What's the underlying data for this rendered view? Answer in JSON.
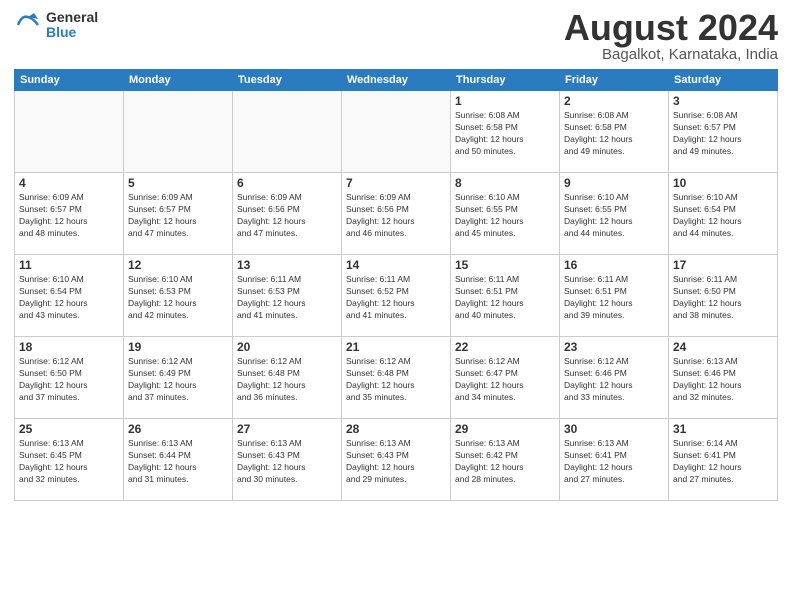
{
  "logo": {
    "general": "General",
    "blue": "Blue"
  },
  "title": {
    "month": "August 2024",
    "location": "Bagalkot, Karnataka, India"
  },
  "weekdays": [
    "Sunday",
    "Monday",
    "Tuesday",
    "Wednesday",
    "Thursday",
    "Friday",
    "Saturday"
  ],
  "weeks": [
    [
      {
        "day": "",
        "info": ""
      },
      {
        "day": "",
        "info": ""
      },
      {
        "day": "",
        "info": ""
      },
      {
        "day": "",
        "info": ""
      },
      {
        "day": "1",
        "info": "Sunrise: 6:08 AM\nSunset: 6:58 PM\nDaylight: 12 hours\nand 50 minutes."
      },
      {
        "day": "2",
        "info": "Sunrise: 6:08 AM\nSunset: 6:58 PM\nDaylight: 12 hours\nand 49 minutes."
      },
      {
        "day": "3",
        "info": "Sunrise: 6:08 AM\nSunset: 6:57 PM\nDaylight: 12 hours\nand 49 minutes."
      }
    ],
    [
      {
        "day": "4",
        "info": "Sunrise: 6:09 AM\nSunset: 6:57 PM\nDaylight: 12 hours\nand 48 minutes."
      },
      {
        "day": "5",
        "info": "Sunrise: 6:09 AM\nSunset: 6:57 PM\nDaylight: 12 hours\nand 47 minutes."
      },
      {
        "day": "6",
        "info": "Sunrise: 6:09 AM\nSunset: 6:56 PM\nDaylight: 12 hours\nand 47 minutes."
      },
      {
        "day": "7",
        "info": "Sunrise: 6:09 AM\nSunset: 6:56 PM\nDaylight: 12 hours\nand 46 minutes."
      },
      {
        "day": "8",
        "info": "Sunrise: 6:10 AM\nSunset: 6:55 PM\nDaylight: 12 hours\nand 45 minutes."
      },
      {
        "day": "9",
        "info": "Sunrise: 6:10 AM\nSunset: 6:55 PM\nDaylight: 12 hours\nand 44 minutes."
      },
      {
        "day": "10",
        "info": "Sunrise: 6:10 AM\nSunset: 6:54 PM\nDaylight: 12 hours\nand 44 minutes."
      }
    ],
    [
      {
        "day": "11",
        "info": "Sunrise: 6:10 AM\nSunset: 6:54 PM\nDaylight: 12 hours\nand 43 minutes."
      },
      {
        "day": "12",
        "info": "Sunrise: 6:10 AM\nSunset: 6:53 PM\nDaylight: 12 hours\nand 42 minutes."
      },
      {
        "day": "13",
        "info": "Sunrise: 6:11 AM\nSunset: 6:53 PM\nDaylight: 12 hours\nand 41 minutes."
      },
      {
        "day": "14",
        "info": "Sunrise: 6:11 AM\nSunset: 6:52 PM\nDaylight: 12 hours\nand 41 minutes."
      },
      {
        "day": "15",
        "info": "Sunrise: 6:11 AM\nSunset: 6:51 PM\nDaylight: 12 hours\nand 40 minutes."
      },
      {
        "day": "16",
        "info": "Sunrise: 6:11 AM\nSunset: 6:51 PM\nDaylight: 12 hours\nand 39 minutes."
      },
      {
        "day": "17",
        "info": "Sunrise: 6:11 AM\nSunset: 6:50 PM\nDaylight: 12 hours\nand 38 minutes."
      }
    ],
    [
      {
        "day": "18",
        "info": "Sunrise: 6:12 AM\nSunset: 6:50 PM\nDaylight: 12 hours\nand 37 minutes."
      },
      {
        "day": "19",
        "info": "Sunrise: 6:12 AM\nSunset: 6:49 PM\nDaylight: 12 hours\nand 37 minutes."
      },
      {
        "day": "20",
        "info": "Sunrise: 6:12 AM\nSunset: 6:48 PM\nDaylight: 12 hours\nand 36 minutes."
      },
      {
        "day": "21",
        "info": "Sunrise: 6:12 AM\nSunset: 6:48 PM\nDaylight: 12 hours\nand 35 minutes."
      },
      {
        "day": "22",
        "info": "Sunrise: 6:12 AM\nSunset: 6:47 PM\nDaylight: 12 hours\nand 34 minutes."
      },
      {
        "day": "23",
        "info": "Sunrise: 6:12 AM\nSunset: 6:46 PM\nDaylight: 12 hours\nand 33 minutes."
      },
      {
        "day": "24",
        "info": "Sunrise: 6:13 AM\nSunset: 6:46 PM\nDaylight: 12 hours\nand 32 minutes."
      }
    ],
    [
      {
        "day": "25",
        "info": "Sunrise: 6:13 AM\nSunset: 6:45 PM\nDaylight: 12 hours\nand 32 minutes."
      },
      {
        "day": "26",
        "info": "Sunrise: 6:13 AM\nSunset: 6:44 PM\nDaylight: 12 hours\nand 31 minutes."
      },
      {
        "day": "27",
        "info": "Sunrise: 6:13 AM\nSunset: 6:43 PM\nDaylight: 12 hours\nand 30 minutes."
      },
      {
        "day": "28",
        "info": "Sunrise: 6:13 AM\nSunset: 6:43 PM\nDaylight: 12 hours\nand 29 minutes."
      },
      {
        "day": "29",
        "info": "Sunrise: 6:13 AM\nSunset: 6:42 PM\nDaylight: 12 hours\nand 28 minutes."
      },
      {
        "day": "30",
        "info": "Sunrise: 6:13 AM\nSunset: 6:41 PM\nDaylight: 12 hours\nand 27 minutes."
      },
      {
        "day": "31",
        "info": "Sunrise: 6:14 AM\nSunset: 6:41 PM\nDaylight: 12 hours\nand 27 minutes."
      }
    ]
  ]
}
